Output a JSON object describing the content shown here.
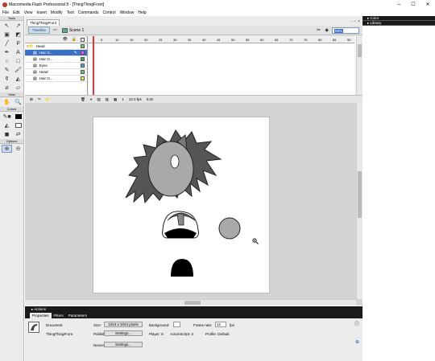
{
  "window": {
    "title": "Macromedia Flash Professional 8 - [ThingThingFront]",
    "min": "─",
    "max": "☐",
    "close": "✕"
  },
  "menu": [
    "File",
    "Edit",
    "View",
    "Insert",
    "Modify",
    "Text",
    "Commands",
    "Control",
    "Window",
    "Help"
  ],
  "tools": {
    "label": "Tools",
    "view_label": "View",
    "colors_label": "Colors",
    "options_label": "Options"
  },
  "document": {
    "tab": "ThingThingFront",
    "close": "- ♂ ×",
    "timeline_toggle": "Timeline",
    "scene": "Scene 1",
    "zoom": "93%"
  },
  "timeline": {
    "layers": [
      {
        "name": "Head",
        "selected": false,
        "folder": true
      },
      {
        "name": "Hair O...",
        "selected": true,
        "folder": false
      },
      {
        "name": "Hair O...",
        "selected": false,
        "folder": false
      },
      {
        "name": "Eyes",
        "selected": false,
        "folder": false
      },
      {
        "name": "Head",
        "selected": false,
        "folder": false
      },
      {
        "name": "Hair O...",
        "selected": false,
        "folder": false
      }
    ],
    "ruler": [
      "5",
      "10",
      "15",
      "20",
      "25",
      "30",
      "35",
      "40",
      "45",
      "50",
      "55",
      "60",
      "65",
      "70",
      "75",
      "80",
      "85",
      "90"
    ],
    "frame": "1",
    "fps": "12.0 fps",
    "time": "0.0s"
  },
  "right_panels": {
    "color": "Color",
    "library": "Library"
  },
  "bottom": {
    "actions": "Actions",
    "tabs": [
      "Properties",
      "Filters",
      "Parameters"
    ],
    "doc_type": "Document",
    "doc_name": "ThingThingFront",
    "size_label": "Size:",
    "size_value": "1024 x 1024 pixels",
    "background_label": "Background:",
    "frame_rate_label": "Frame rate:",
    "frame_rate_value": "12",
    "fps": "fps",
    "publish_label": "Publish:",
    "settings_btn": "Settings...",
    "player": "Player: 8",
    "actionscript": "ActionScript: 2",
    "profile": "Profile: Default",
    "device_label": "Device:",
    "device_btn": "Settings..."
  }
}
